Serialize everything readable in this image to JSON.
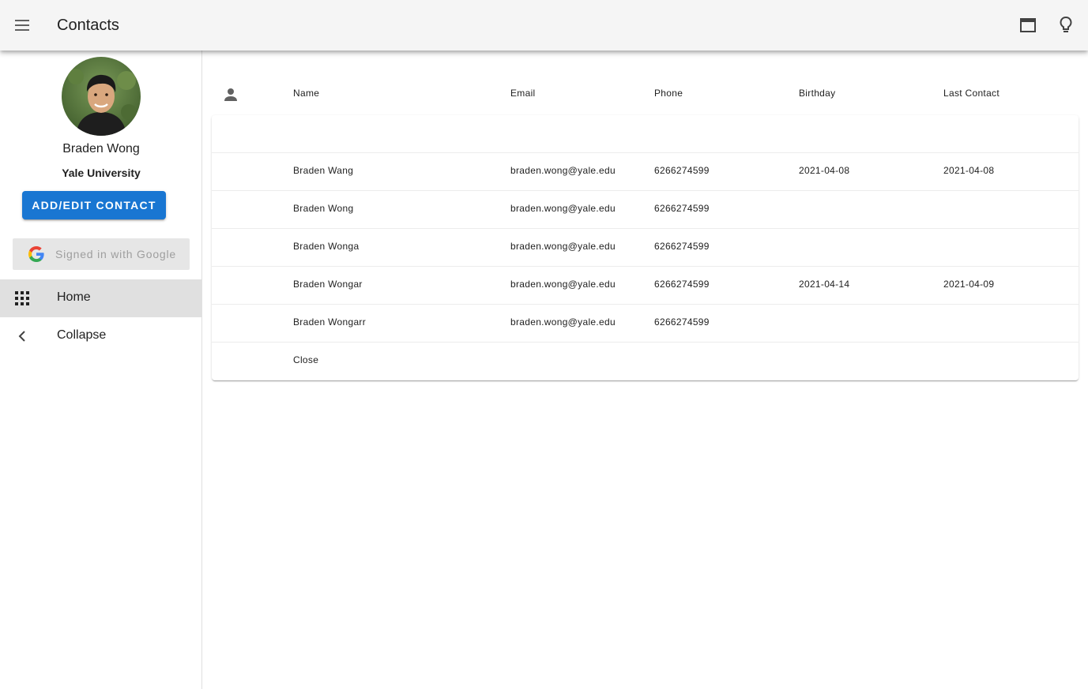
{
  "appbar": {
    "title": "Contacts",
    "icons": [
      "menu-icon",
      "window-icon",
      "lightbulb-icon"
    ]
  },
  "sidebar": {
    "profile": {
      "name": "Braden Wong",
      "organization": "Yale University"
    },
    "add_button_label": "ADD/EDIT CONTACT",
    "google_label": "Signed in with Google",
    "nav": [
      {
        "label": "Home",
        "icon": "apps-grid-icon",
        "selected": true
      },
      {
        "label": "Collapse",
        "icon": "chevron-left-icon",
        "selected": false
      }
    ]
  },
  "table": {
    "headers": {
      "avatar_icon": "person-icon",
      "name": "Name",
      "email": "Email",
      "phone": "Phone",
      "birthday": "Birthday",
      "last_contact": "Last Contact"
    },
    "rows": [
      {
        "name": "",
        "email": "",
        "phone": "",
        "birthday": "",
        "last_contact": ""
      },
      {
        "name": "Braden Wang",
        "email": "braden.wong@yale.edu",
        "phone": "6266274599",
        "birthday": "2021-04-08",
        "last_contact": "2021-04-08"
      },
      {
        "name": "Braden Wong",
        "email": "braden.wong@yale.edu",
        "phone": "6266274599",
        "birthday": "",
        "last_contact": ""
      },
      {
        "name": "Braden Wonga",
        "email": "braden.wong@yale.edu",
        "phone": "6266274599",
        "birthday": "",
        "last_contact": ""
      },
      {
        "name": "Braden Wongar",
        "email": "braden.wong@yale.edu",
        "phone": "6266274599",
        "birthday": "2021-04-14",
        "last_contact": "2021-04-09"
      },
      {
        "name": "Braden Wongarr",
        "email": "braden.wong@yale.edu",
        "phone": "6266274599",
        "birthday": "",
        "last_contact": ""
      },
      {
        "name": "Close",
        "email": "",
        "phone": "",
        "birthday": "",
        "last_contact": ""
      }
    ]
  },
  "colors": {
    "appbar_bg": "#f5f5f5",
    "primary": "#1976d2",
    "nav_selected_bg": "#e0e0e0",
    "google_btn_bg": "#e6e6e6"
  }
}
